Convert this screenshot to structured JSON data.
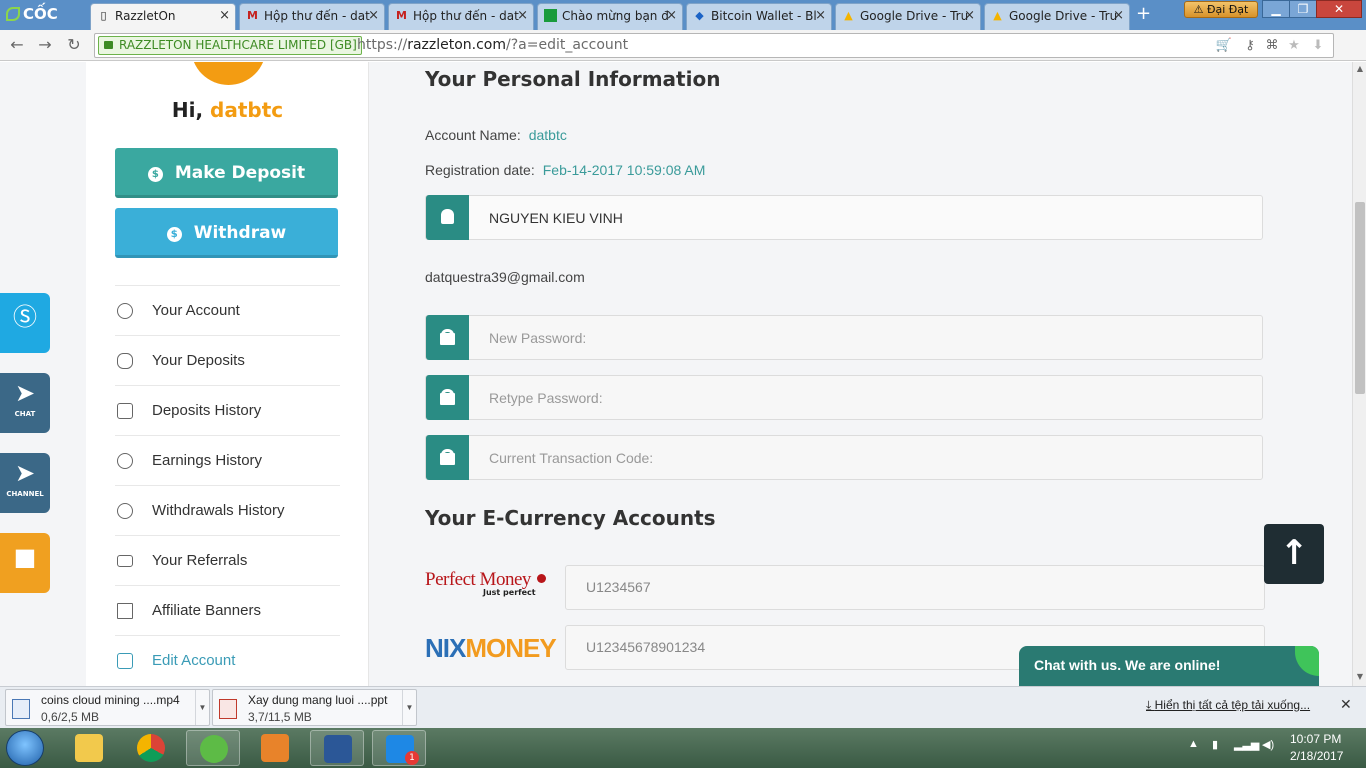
{
  "browser": {
    "logo_text": "CỐC CỐC",
    "tabs": [
      {
        "label": "RazzletOn",
        "icon": "page-icon",
        "active": true
      },
      {
        "label": "Hộp thư đến - dat",
        "icon": "gmail-icon"
      },
      {
        "label": "Hộp thư đến - dat",
        "icon": "gmail-icon"
      },
      {
        "label": "Chào mừng bạn đ",
        "icon": "green-doc-icon"
      },
      {
        "label": "Bitcoin Wallet - Bl",
        "icon": "blockchain-icon"
      },
      {
        "label": "Google Drive - Tru",
        "icon": "drive-icon"
      },
      {
        "label": "Google Drive - Tru",
        "icon": "drive-icon"
      }
    ],
    "user_name": "Đại Đạt",
    "ev_label": "RAZZLETON HEALTHCARE LIMITED [GB]",
    "url_scheme": "https://",
    "url_host": "razzleton.com",
    "url_path": "/?a=edit_account"
  },
  "sidebar": {
    "greeting": "Hi,",
    "username": "datbtc",
    "deposit_label": "Make Deposit",
    "withdraw_label": "Withdraw",
    "menu": [
      {
        "label": "Your Account",
        "icon": "user-icon"
      },
      {
        "label": "Your Deposits",
        "icon": "coins-stack-icon"
      },
      {
        "label": "Deposits History",
        "icon": "calendar-icon"
      },
      {
        "label": "Earnings History",
        "icon": "coins-plus-icon"
      },
      {
        "label": "Withdrawals History",
        "icon": "coins-minus-icon"
      },
      {
        "label": "Your Referrals",
        "icon": "envelope-icon"
      },
      {
        "label": "Affiliate Banners",
        "icon": "banner-icon"
      },
      {
        "label": "Edit Account",
        "icon": "edit-icon",
        "active": true
      }
    ]
  },
  "social": {
    "chat_caption": "CHAT",
    "channel_caption": "CHANNEL"
  },
  "main": {
    "personal_title": "Your Personal Information",
    "account_name_label": "Account Name:",
    "account_name_value": "datbtc",
    "registration_label": "Registration date:",
    "registration_value": "Feb-14-2017 10:59:08 AM",
    "full_name": "NGUYEN KIEU VINH",
    "email": "datquestra39@gmail.com",
    "new_password_placeholder": "New Password:",
    "retype_password_placeholder": "Retype Password:",
    "transaction_code_placeholder": "Current Transaction Code:",
    "currency_title": "Your E-Currency Accounts",
    "perfect_money_logo": "Perfect Money",
    "perfect_money_tagline": "Just perfect",
    "perfect_money_account": "U1234567",
    "nix_logo_a": "NIX",
    "nix_logo_b": "MONEY",
    "nix_account": "U12345678901234",
    "chat_widget": "Chat with us. We are online!"
  },
  "downloads": {
    "items": [
      {
        "name": "coins cloud mining ....mp4",
        "size": "0,6/2,5 MB"
      },
      {
        "name": "Xay dung mang luoi ....ppt",
        "size": "3,7/11,5 MB"
      }
    ],
    "show_all": "Hiển thị tất cả tệp tải xuống..."
  },
  "taskbar": {
    "time": "10:07 PM",
    "date": "2/18/2017",
    "zalo_badge": "1"
  },
  "colors": {
    "accent_teal": "#2a8c84",
    "accent_orange": "#f39c12",
    "link_blue": "#3a9bb6"
  }
}
